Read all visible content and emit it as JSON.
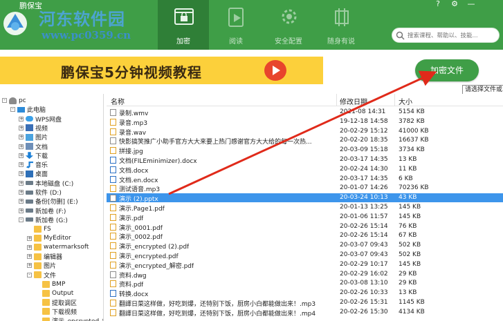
{
  "app": {
    "name": "鹏保宝"
  },
  "watermark": {
    "title": "河东软件园",
    "url": "www.pc0359.cn"
  },
  "nav": [
    {
      "label": "加密",
      "icon": "lock-window-icon",
      "active": true
    },
    {
      "label": "阅读",
      "icon": "play-document-icon",
      "active": false
    },
    {
      "label": "安全配置",
      "icon": "gear-shield-icon",
      "active": false
    },
    {
      "label": "随身有说",
      "icon": "usb-chip-icon",
      "active": false
    }
  ],
  "window": {
    "menu": "?",
    "settings": "⚙",
    "minimize": "—"
  },
  "search": {
    "placeholder": "搜索课程、帮助以、技能..."
  },
  "banner": {
    "text": "鹏保宝5分钟视频教程"
  },
  "encrypt_button": {
    "label": "加密文件"
  },
  "tooltip": {
    "text": "请选择文件或"
  },
  "tree": [
    {
      "label": "pc",
      "icon": "user-icon",
      "exp": "-",
      "indent": 0
    },
    {
      "label": "此电脑",
      "icon": "computer-icon",
      "exp": "-",
      "indent": 1
    },
    {
      "label": "WPS网盘",
      "icon": "cloud-icon",
      "exp": "+",
      "indent": 2
    },
    {
      "label": "视频",
      "icon": "video-folder-icon",
      "exp": "+",
      "indent": 2
    },
    {
      "label": "图片",
      "icon": "picture-folder-icon",
      "exp": "+",
      "indent": 2
    },
    {
      "label": "文档",
      "icon": "document-folder-icon",
      "exp": "+",
      "indent": 2
    },
    {
      "label": "下载",
      "icon": "download-icon",
      "exp": "+",
      "indent": 2
    },
    {
      "label": "音乐",
      "icon": "music-icon",
      "exp": "+",
      "indent": 2
    },
    {
      "label": "桌面",
      "icon": "desktop-icon",
      "exp": "+",
      "indent": 2
    },
    {
      "label": "本地磁盘 (C:)",
      "icon": "drive-icon",
      "exp": "+",
      "indent": 2
    },
    {
      "label": "软件 (D:)",
      "icon": "drive-icon",
      "exp": "+",
      "indent": 2
    },
    {
      "label": "备份[勿删] (E:)",
      "icon": "drive-icon",
      "exp": "+",
      "indent": 2
    },
    {
      "label": "新加卷 (F:)",
      "icon": "drive-icon",
      "exp": "+",
      "indent": 2
    },
    {
      "label": "新加卷 (G:)",
      "icon": "drive-icon",
      "exp": "-",
      "indent": 2
    },
    {
      "label": "FS",
      "icon": "folder-icon",
      "exp": "",
      "indent": 3
    },
    {
      "label": "MyEditor",
      "icon": "folder-icon",
      "exp": "+",
      "indent": 3
    },
    {
      "label": "watermarksoft",
      "icon": "folder-icon",
      "exp": "+",
      "indent": 3
    },
    {
      "label": "编辑器",
      "icon": "folder-icon",
      "exp": "+",
      "indent": 3
    },
    {
      "label": "图片",
      "icon": "folder-icon",
      "exp": "+",
      "indent": 3
    },
    {
      "label": "文件",
      "icon": "folder-icon",
      "exp": "-",
      "indent": 3
    },
    {
      "label": "BMP",
      "icon": "folder-icon",
      "exp": "",
      "indent": 4
    },
    {
      "label": "Output",
      "icon": "folder-icon",
      "exp": "",
      "indent": 4
    },
    {
      "label": "提取调区",
      "icon": "folder-icon",
      "exp": "",
      "indent": 4
    },
    {
      "label": "下载视频",
      "icon": "folder-icon",
      "exp": "",
      "indent": 4
    },
    {
      "label": "演示_encrypted_解密",
      "icon": "folder-icon",
      "exp": "",
      "indent": 4
    }
  ],
  "columns": {
    "name": "名称",
    "date": "修改日期",
    "size": "大小"
  },
  "files": [
    {
      "name": "录制.wmv",
      "date": "2021-08 14:31",
      "size": "5154 KB",
      "kind": "gray"
    },
    {
      "name": "录音.mp3",
      "date": "19-12-18 14:58",
      "size": "3782 KB",
      "kind": "orange"
    },
    {
      "name": "录音.wav",
      "date": "20-02-29 15:12",
      "size": "41000 KB",
      "kind": "orange"
    },
    {
      "name": "快影搞笑推广小助手官方大大来要上热门感谢官方大大给的每一次热...",
      "date": "20-02-20 18:35",
      "size": "16637 KB",
      "kind": "gray"
    },
    {
      "name": "拼接.jpg",
      "date": "20-03-09 15:18",
      "size": "3734 KB",
      "kind": "orange"
    },
    {
      "name": "文档(FILEminimizer).docx",
      "date": "20-03-17 14:35",
      "size": "13 KB",
      "kind": "blue"
    },
    {
      "name": "文档.docx",
      "date": "20-02-24 14:30",
      "size": "11 KB",
      "kind": "blue"
    },
    {
      "name": "文档.en.docx",
      "date": "20-03-17 14:35",
      "size": "6 KB",
      "kind": "blue"
    },
    {
      "name": "测试语音.mp3",
      "date": "20-01-07 14:26",
      "size": "70236 KB",
      "kind": "orange"
    },
    {
      "name": "演示 (2).pptx",
      "date": "20-03-24 10:13",
      "size": "43 KB",
      "kind": "gray",
      "selected": true
    },
    {
      "name": "演示.Page1.pdf",
      "date": "20-01-13 13:25",
      "size": "145 KB",
      "kind": "orange"
    },
    {
      "name": "演示.pdf",
      "date": "20-01-06 11:57",
      "size": "145 KB",
      "kind": "orange"
    },
    {
      "name": "演示_0001.pdf",
      "date": "20-02-26 15:14",
      "size": "76 KB",
      "kind": "orange"
    },
    {
      "name": "演示_0002.pdf",
      "date": "20-02-26 15:14",
      "size": "67 KB",
      "kind": "orange"
    },
    {
      "name": "演示_encrypted (2).pdf",
      "date": "20-03-07 09:43",
      "size": "502 KB",
      "kind": "orange"
    },
    {
      "name": "演示_encrypted.pdf",
      "date": "20-03-07 09:43",
      "size": "502 KB",
      "kind": "orange"
    },
    {
      "name": "演示_encrypted_解密.pdf",
      "date": "20-02-29 10:17",
      "size": "145 KB",
      "kind": "orange"
    },
    {
      "name": "资料.dwg",
      "date": "20-02-29 16:02",
      "size": "29 KB",
      "kind": "gray"
    },
    {
      "name": "资料.pdf",
      "date": "20-03-08 13:10",
      "size": "29 KB",
      "kind": "orange"
    },
    {
      "name": "转换.docx",
      "date": "20-02-26 10:33",
      "size": "13 KB",
      "kind": "blue"
    },
    {
      "name": "翻譯日菜这样做，好吃到爆，还特别下饭，厨房小白都能做出来！.mp3",
      "date": "20-02-26 15:31",
      "size": "1145 KB",
      "kind": "orange"
    },
    {
      "name": "翻譯日菜这样做，好吃到爆，还特别下饭，厨房小白都能做出来！.mp4",
      "date": "20-02-26 15:30",
      "size": "4134 KB",
      "kind": "orange"
    }
  ],
  "colors": {
    "header": "#3f9e47",
    "nav_active": "#2f7f37",
    "selection": "#3d95eb",
    "banner": "#fcd03b",
    "arrow": "#e02a1a"
  }
}
